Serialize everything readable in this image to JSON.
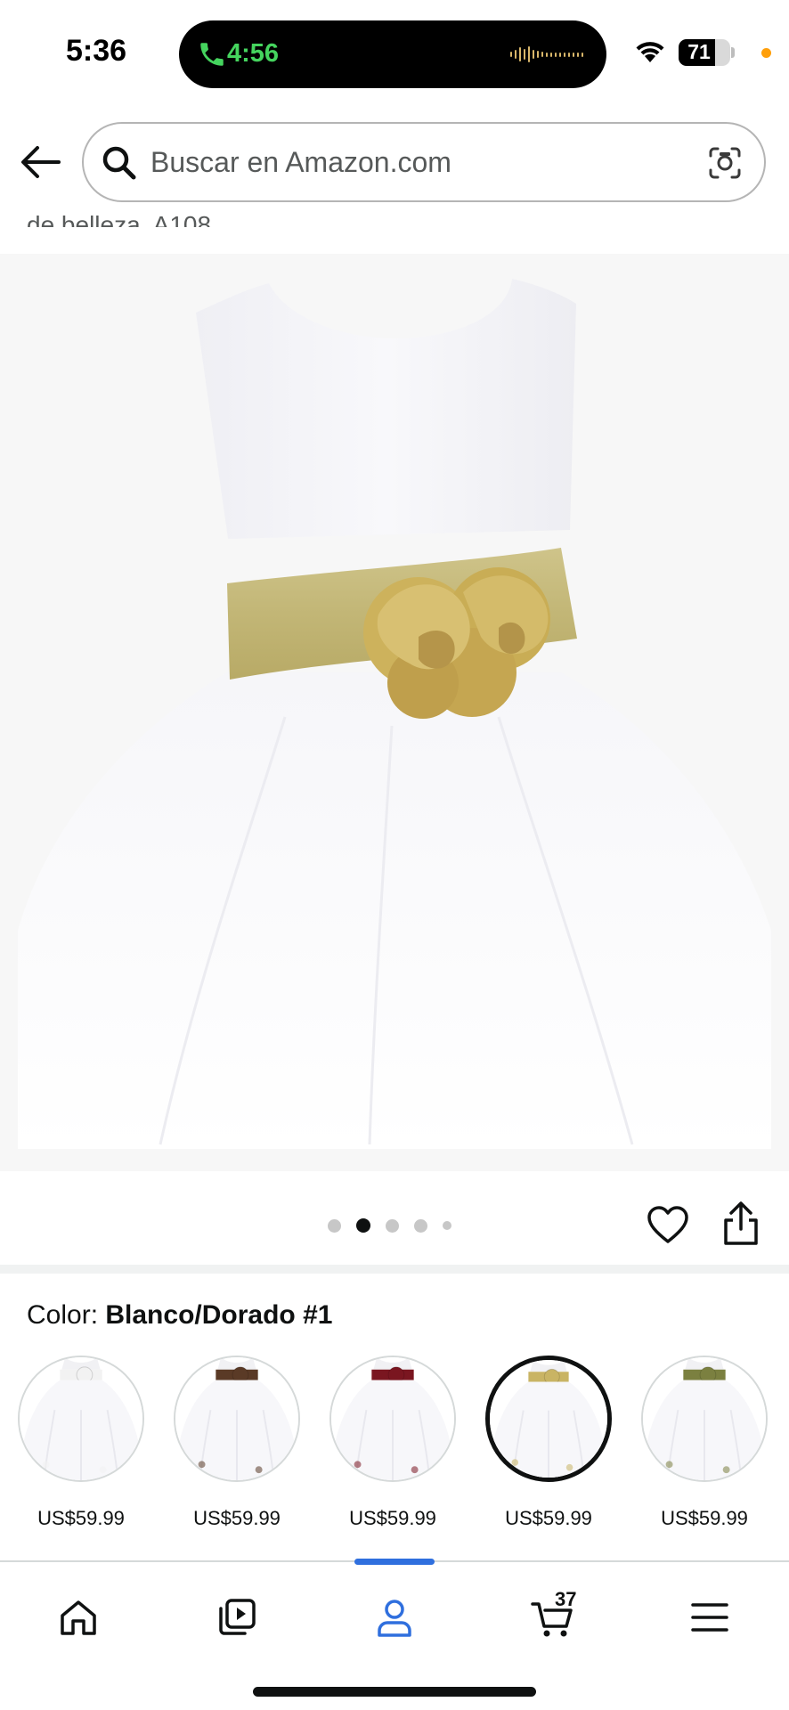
{
  "status_bar": {
    "time": "5:36",
    "call_time": "4:56",
    "battery_level": "71",
    "battery_fraction": 0.71
  },
  "search": {
    "placeholder": "Buscar en Amazon.com"
  },
  "product": {
    "title_clipped": "de belleza, A108",
    "image_count": 5,
    "active_image_index": 1
  },
  "color": {
    "label": "Color:",
    "selected_name": "Blanco/Dorado #1",
    "options": [
      {
        "price": "US$59.99",
        "sash_color": "#f2f2f2",
        "selected": false
      },
      {
        "price": "US$59.99",
        "sash_color": "#5a3a26",
        "selected": false
      },
      {
        "price": "US$59.99",
        "sash_color": "#7a1620",
        "selected": false
      },
      {
        "price": "US$59.99",
        "sash_color": "#c9b464",
        "selected": true
      },
      {
        "price": "US$59.99",
        "sash_color": "#7b8040",
        "selected": false
      }
    ]
  },
  "bottom_nav": {
    "items": [
      "home",
      "video",
      "account",
      "cart",
      "menu"
    ],
    "active": "account",
    "cart_count": "37"
  },
  "colors": {
    "accent_blue": "#2f6fde",
    "call_green": "#45d45e",
    "privacy_orange": "#ff9f0a"
  }
}
